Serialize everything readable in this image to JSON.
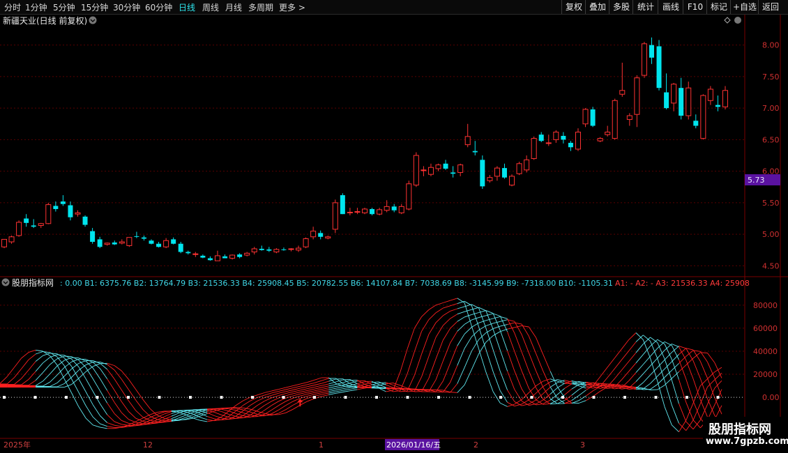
{
  "toolbar": {
    "timeframes": [
      "分时",
      "1分钟",
      "5分钟",
      "15分钟",
      "30分钟",
      "60分钟",
      "日线",
      "周线",
      "月线",
      "多周期",
      "更多 >"
    ],
    "active_timeframe": "日线",
    "right_buttons": [
      "复权",
      "叠加",
      "多股",
      "统计",
      "画线",
      "F10",
      "标记",
      "+自选",
      "返回"
    ]
  },
  "main_panel": {
    "title": "新疆天业(日线 前复权)",
    "current_price_tag": "5.73"
  },
  "indicator_panel": {
    "title": "股朋指标网",
    "values_text": ": 0.00  B1: 6375.76  B2: 13764.79  B3: 21536.33  B4: 25908.45  B5: 20782.55  B6: 14107.84  B7: 7038.69  B8: -3145.99  B9: -7318.00  B10: -1105.31",
    "values_text_red": "A1: -  A2: -  A3: 21536.33  A4: 25908"
  },
  "date_axis": {
    "labels": [
      "2025年",
      "12",
      "1",
      "2",
      "3"
    ],
    "cursor_date": "2026/01/16/五"
  },
  "watermark": {
    "line1": "股朋指标网",
    "line2": "www.7gpzb.com"
  },
  "colors": {
    "up": "#ff3232",
    "down": "#00e5ee",
    "grid": "#5a0000",
    "cyan_line": "#60e8f0",
    "red_line": "#ff2020",
    "price_tag_bg": "#5a12a0",
    "dotted": "#e0e0e0"
  },
  "chart_data": [
    {
      "type": "candlestick",
      "title": "新疆天业(日线 前复权)",
      "y_ticks": [
        4.5,
        5.0,
        5.5,
        6.0,
        6.5,
        7.0,
        7.5,
        8.0
      ],
      "ylim": [
        4.35,
        8.25
      ],
      "candles": [
        [
          4.8,
          4.92,
          4.78,
          4.92
        ],
        [
          4.88,
          4.98,
          4.85,
          4.96
        ],
        [
          4.98,
          5.22,
          4.96,
          5.19
        ],
        [
          5.25,
          5.32,
          5.12,
          5.18
        ],
        [
          5.14,
          5.24,
          5.1,
          5.12
        ],
        [
          5.14,
          5.18,
          5.1,
          5.17
        ],
        [
          5.17,
          5.5,
          5.16,
          5.47
        ],
        [
          5.45,
          5.52,
          5.36,
          5.4
        ],
        [
          5.52,
          5.62,
          5.45,
          5.48
        ],
        [
          5.46,
          5.52,
          5.22,
          5.27
        ],
        [
          5.32,
          5.38,
          5.28,
          5.34
        ],
        [
          5.28,
          5.3,
          5.12,
          5.15
        ],
        [
          5.05,
          5.1,
          4.85,
          4.88
        ],
        [
          4.92,
          4.96,
          4.78,
          4.8
        ],
        [
          4.84,
          4.87,
          4.82,
          4.86
        ],
        [
          4.87,
          4.9,
          4.83,
          4.84
        ],
        [
          4.86,
          4.92,
          4.84,
          4.88
        ],
        [
          4.82,
          4.95,
          4.8,
          4.95
        ],
        [
          4.97,
          5.04,
          4.94,
          4.96
        ],
        [
          4.95,
          4.98,
          4.9,
          4.93
        ],
        [
          4.9,
          4.92,
          4.84,
          4.85
        ],
        [
          4.85,
          4.88,
          4.79,
          4.8
        ],
        [
          4.8,
          4.94,
          4.78,
          4.9
        ],
        [
          4.92,
          4.95,
          4.84,
          4.85
        ],
        [
          4.85,
          4.88,
          4.7,
          4.72
        ],
        [
          4.72,
          4.74,
          4.68,
          4.7
        ],
        [
          4.68,
          4.72,
          4.64,
          4.69
        ],
        [
          4.66,
          4.68,
          4.62,
          4.63
        ],
        [
          4.62,
          4.65,
          4.58,
          4.59
        ],
        [
          4.58,
          4.74,
          4.58,
          4.66
        ],
        [
          4.65,
          4.68,
          4.62,
          4.62
        ],
        [
          4.62,
          4.68,
          4.6,
          4.67
        ],
        [
          4.68,
          4.7,
          4.62,
          4.64
        ],
        [
          4.67,
          4.72,
          4.65,
          4.7
        ],
        [
          4.72,
          4.8,
          4.68,
          4.77
        ],
        [
          4.77,
          4.82,
          4.74,
          4.75
        ],
        [
          4.76,
          4.8,
          4.72,
          4.74
        ],
        [
          4.72,
          4.78,
          4.7,
          4.76
        ],
        [
          4.76,
          4.79,
          4.74,
          4.75
        ],
        [
          4.76,
          4.78,
          4.73,
          4.77
        ],
        [
          4.75,
          4.82,
          4.72,
          4.78
        ],
        [
          4.8,
          4.95,
          4.78,
          4.93
        ],
        [
          4.96,
          5.12,
          4.92,
          5.05
        ],
        [
          5.02,
          5.06,
          4.92,
          4.96
        ],
        [
          4.94,
          4.98,
          4.92,
          4.96
        ],
        [
          5.08,
          5.55,
          5.02,
          5.5
        ],
        [
          5.62,
          5.65,
          5.32,
          5.32
        ],
        [
          5.34,
          5.42,
          5.3,
          5.35
        ],
        [
          5.36,
          5.42,
          5.32,
          5.36
        ],
        [
          5.34,
          5.42,
          5.32,
          5.4
        ],
        [
          5.4,
          5.42,
          5.3,
          5.32
        ],
        [
          5.32,
          5.42,
          5.3,
          5.39
        ],
        [
          5.38,
          5.54,
          5.35,
          5.44
        ],
        [
          5.44,
          5.48,
          5.35,
          5.38
        ],
        [
          5.34,
          5.48,
          5.32,
          5.44
        ],
        [
          5.4,
          5.85,
          5.38,
          5.8
        ],
        [
          5.78,
          6.3,
          5.75,
          6.25
        ],
        [
          6.02,
          6.08,
          5.92,
          6.02
        ],
        [
          5.95,
          6.12,
          5.92,
          6.06
        ],
        [
          6.04,
          6.12,
          6.0,
          6.1
        ],
        [
          6.12,
          6.18,
          6.02,
          6.04
        ],
        [
          5.98,
          6.08,
          5.9,
          5.96
        ],
        [
          5.98,
          6.12,
          5.92,
          6.1
        ],
        [
          6.42,
          6.75,
          6.38,
          6.55
        ],
        [
          6.32,
          6.48,
          6.25,
          6.3
        ],
        [
          6.18,
          6.25,
          5.72,
          5.76
        ],
        [
          5.85,
          5.94,
          5.82,
          5.9
        ],
        [
          5.92,
          6.08,
          5.85,
          6.05
        ],
        [
          6.05,
          6.12,
          5.88,
          5.9
        ],
        [
          5.78,
          5.95,
          5.76,
          5.92
        ],
        [
          5.96,
          6.15,
          5.94,
          6.12
        ],
        [
          6.02,
          6.25,
          5.98,
          6.18
        ],
        [
          6.2,
          6.55,
          6.18,
          6.52
        ],
        [
          6.58,
          6.62,
          6.46,
          6.48
        ],
        [
          6.45,
          6.58,
          6.4,
          6.45
        ],
        [
          6.5,
          6.65,
          6.45,
          6.62
        ],
        [
          6.56,
          6.62,
          6.44,
          6.5
        ],
        [
          6.45,
          6.48,
          6.32,
          6.38
        ],
        [
          6.35,
          6.68,
          6.32,
          6.62
        ],
        [
          6.75,
          7.0,
          6.7,
          6.98
        ],
        [
          6.98,
          7.02,
          6.7,
          6.72
        ],
        [
          6.48,
          6.54,
          6.46,
          6.52
        ],
        [
          6.58,
          6.72,
          6.55,
          6.62
        ],
        [
          6.52,
          7.15,
          6.5,
          7.12
        ],
        [
          7.22,
          7.72,
          7.18,
          7.28
        ],
        [
          6.82,
          6.92,
          6.72,
          6.88
        ],
        [
          6.9,
          7.52,
          6.7,
          7.48
        ],
        [
          7.52,
          8.05,
          7.48,
          8.02
        ],
        [
          8.0,
          8.12,
          7.7,
          7.8
        ],
        [
          7.98,
          8.08,
          7.28,
          7.32
        ],
        [
          7.25,
          7.55,
          6.98,
          7.0
        ],
        [
          7.08,
          7.4,
          6.95,
          7.38
        ],
        [
          7.32,
          7.48,
          6.82,
          6.88
        ],
        [
          6.88,
          7.42,
          6.82,
          7.32
        ],
        [
          6.8,
          6.9,
          6.68,
          6.72
        ],
        [
          6.52,
          7.22,
          6.5,
          7.2
        ],
        [
          7.12,
          7.35,
          7.05,
          7.3
        ],
        [
          7.05,
          7.2,
          6.95,
          7.02
        ],
        [
          7.02,
          7.35,
          6.98,
          7.28
        ]
      ]
    },
    {
      "type": "line",
      "title": "股朋指标网",
      "y_ticks": [
        0,
        20000,
        40000,
        60000,
        80000
      ],
      "ylim": [
        -35000,
        92000
      ],
      "series_count": 10,
      "base_series": [
        12000,
        18000,
        26000,
        34000,
        39000,
        41000,
        40000,
        36000,
        28000,
        16000,
        4000,
        -8000,
        -18000,
        -24000,
        -26000,
        -27000,
        -27000,
        -26000,
        -24000,
        -21000,
        -18000,
        -15000,
        -13000,
        -12000,
        -12000,
        -13000,
        -15000,
        -18000,
        -20000,
        -21000,
        -20000,
        -17000,
        -12000,
        -7000,
        -3000,
        0,
        2000,
        4000,
        5500,
        7000,
        8500,
        10000,
        11500,
        13000,
        15000,
        17000,
        17000,
        12000,
        10000,
        9000,
        8500,
        8500,
        9000,
        8000,
        5000,
        6000,
        22000,
        42000,
        60000,
        70000,
        76000,
        80000,
        82000,
        84000,
        86000,
        82000,
        62000,
        42000,
        22000,
        5000,
        -5000,
        -8000,
        -6000,
        -2000,
        4000,
        10000,
        14000,
        16000,
        14000,
        12000,
        12000,
        10000,
        8000,
        10000,
        18000,
        26000,
        34000,
        42000,
        50000,
        56000,
        50000,
        34000,
        14000,
        -8000,
        -24000,
        -30000,
        -20000,
        -5000,
        10000,
        16000,
        22000,
        26000
      ],
      "markers_up_index": [
        34,
        54,
        58,
        60,
        72,
        80,
        84,
        86,
        88,
        90,
        96
      ],
      "arrow_index": 42
    }
  ]
}
